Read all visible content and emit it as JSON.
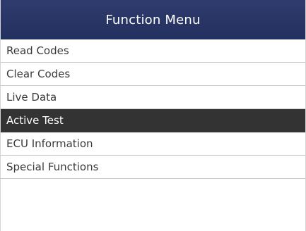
{
  "header": {
    "title": "Function Menu"
  },
  "menu": {
    "items": [
      {
        "label": "Read Codes"
      },
      {
        "label": "Clear Codes"
      },
      {
        "label": "Live Data"
      },
      {
        "label": "Active Test",
        "selected": true
      },
      {
        "label": "ECU Information"
      },
      {
        "label": "Special Functions"
      }
    ]
  },
  "colors": {
    "header_bg": "#26336a",
    "selected_bg": "#333333",
    "text": "#3a3a3a"
  }
}
